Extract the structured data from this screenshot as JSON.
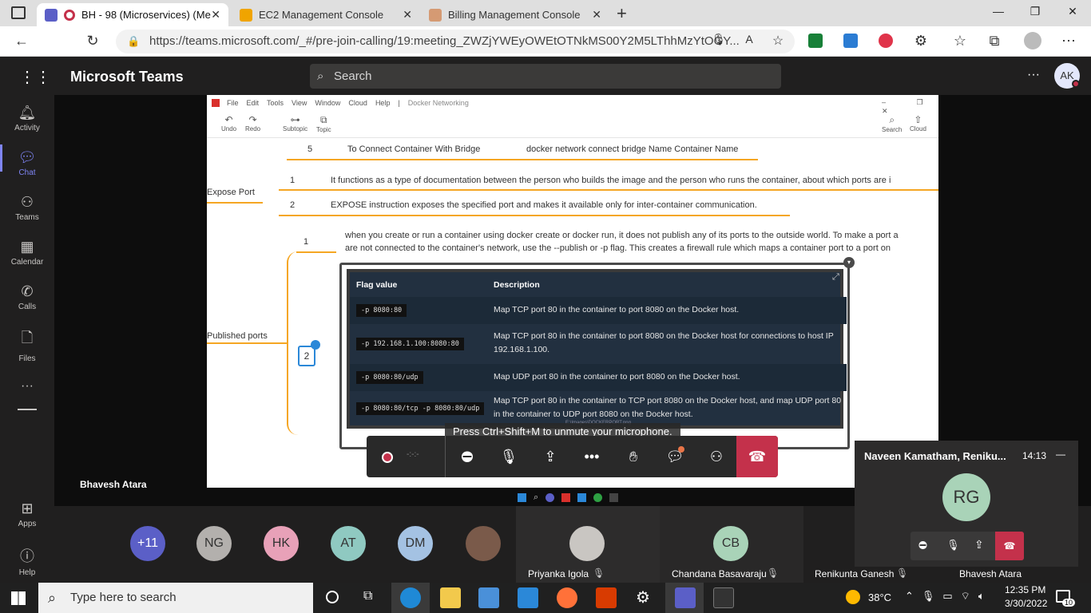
{
  "browser": {
    "tabs": [
      {
        "label": "BH - 98 (Microservices) (Me",
        "active": true,
        "icon": "teams-icon"
      },
      {
        "label": "EC2 Management Console",
        "active": false,
        "icon": "aws-icon"
      },
      {
        "label": "Billing Management Console",
        "active": false,
        "icon": "aws-billing-icon"
      }
    ],
    "new_tab": "+",
    "url": "https://teams.microsoft.com/_#/pre-join-calling/19:meeting_ZWZjYWEyOWEtOTNkMS00Y2M5LThhMzYtOGY..."
  },
  "teams": {
    "title": "Microsoft Teams",
    "search_placeholder": "Search",
    "more": "···",
    "user_initials": "AK",
    "rail": [
      {
        "label": "Activity",
        "icon": "bell-icon"
      },
      {
        "label": "Chat",
        "icon": "chat-icon",
        "active": true
      },
      {
        "label": "Teams",
        "icon": "teams-icon"
      },
      {
        "label": "Calendar",
        "icon": "calendar-icon"
      },
      {
        "label": "Calls",
        "icon": "phone-icon"
      },
      {
        "label": "Files",
        "icon": "file-icon"
      },
      {
        "label": "···",
        "icon": "more-icon"
      },
      {
        "label": "Apps",
        "icon": "apps-icon"
      },
      {
        "label": "Help",
        "icon": "help-icon"
      }
    ]
  },
  "shared_screen": {
    "app_menu": [
      "File",
      "Edit",
      "Tools",
      "View",
      "Window",
      "Cloud",
      "Help"
    ],
    "doc_title": "Docker Networking",
    "toolbar": [
      "Undo",
      "Redo",
      "Subtopic",
      "Topic",
      "Search",
      "Cloud"
    ],
    "row5_num": "5",
    "row5_title": "To Connect Container With Bridge",
    "row5_cmd": "docker network connect bridge Name Container Name",
    "expose_label": "Expose Port",
    "expose_1_num": "1",
    "expose_1": "It functions as a type of documentation between the person who builds the image and the person who runs the container, about which ports are i",
    "expose_2_num": "2",
    "expose_2": "EXPOSE instruction exposes the specified port and makes it available only for inter-container communication.",
    "published_label": "Published ports",
    "pub_1_num": "1",
    "pub_1_line1": "when you create or run a container using docker create or docker run, it does not publish any of its ports to the outside world. To make a port a",
    "pub_1_line2": "are not connected to the container's network, use the --publish or -p flag. This creates a firewall rule which maps a container port to a port on",
    "pub_2_num": "2",
    "table": {
      "headers": [
        "Flag value",
        "Description"
      ],
      "rows": [
        {
          "flag": "-p 8080:80",
          "desc": "Map TCP port 80 in the container to port 8080 on the Docker host."
        },
        {
          "flag": "-p 192.168.1.100:8080:80",
          "desc": "Map TCP port 80 in the container to port 8080 on the Docker host for connections to host IP 192.168.1.100."
        },
        {
          "flag": "-p 8080:80/udp",
          "desc": "Map UDP port 80 in the container to port 8080 on the Docker host."
        },
        {
          "flag": "-p 8080:80/tcp -p 8080:80/udp",
          "desc": "Map TCP port 80 in the container to TCP port 8080 on the Docker host, and map UDP port 80 in the container to UDP port 8080 on the Docker host."
        }
      ],
      "path_caption": "E:\\Images\\DOCKERPORT.png"
    }
  },
  "call": {
    "toast": "Press Ctrl+Shift+M to unmute your microphone.",
    "timer_placeholder": "-:-:-",
    "presenter": "Bhavesh Atara"
  },
  "participants": [
    {
      "initials": "+11",
      "color": "#5b5fc7"
    },
    {
      "initials": "NG",
      "color": "#b3b0ad"
    },
    {
      "initials": "HK",
      "color": "#e8a1b8"
    },
    {
      "initials": "AT",
      "color": "#8fc9c1"
    },
    {
      "initials": "DM",
      "color": "#a4c2e3"
    }
  ],
  "video_tiles": [
    {
      "name": "Priyanka Igola",
      "initials": ""
    },
    {
      "name": "Chandana Basavaraju",
      "initials": "CB",
      "color": "#a9d3b8"
    },
    {
      "name": "Renikunta Ganesh",
      "initials": ""
    },
    {
      "name": "Bhavesh Atara",
      "initials": ""
    }
  ],
  "mini_window": {
    "title": "Naveen Kamatham, Reniku...",
    "time": "14:13",
    "initials": "RG",
    "color": "#a9d3b8"
  },
  "taskbar": {
    "search_placeholder": "Type here to search",
    "weather": "38°C",
    "time": "12:35 PM",
    "date": "3/30/2022",
    "notifications": "10"
  }
}
